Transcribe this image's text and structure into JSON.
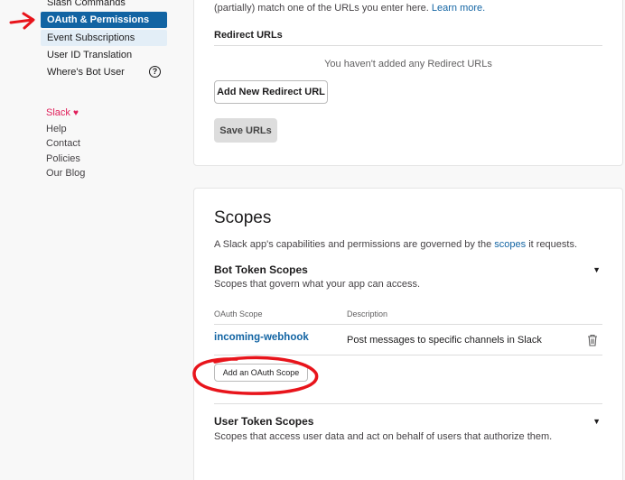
{
  "sidebar": {
    "items": [
      {
        "label": "Slash Commands"
      },
      {
        "label": "OAuth & Permissions"
      },
      {
        "label": "Event Subscriptions"
      },
      {
        "label": "User ID Translation"
      },
      {
        "label": "Where's Bot User"
      }
    ],
    "help_icon_glyph": "?",
    "footer": {
      "slack": "Slack",
      "heart": "♥",
      "help": "Help",
      "contact": "Contact",
      "policies": "Policies",
      "blog": "Our Blog"
    }
  },
  "redirect": {
    "intro_text": "(partially) match one of the URLs you enter here.",
    "learn_more": "Learn more.",
    "section_label": "Redirect URLs",
    "empty_message": "You haven't added any Redirect URLs",
    "add_button": "Add New Redirect URL",
    "save_button": "Save URLs"
  },
  "scopes": {
    "title": "Scopes",
    "description_pre": "A Slack app's capabilities and permissions are governed by the",
    "description_link": "scopes",
    "description_post": "it requests.",
    "bot": {
      "title": "Bot Token Scopes",
      "description": "Scopes that govern what your app can access.",
      "col_scope": "OAuth Scope",
      "col_description": "Description",
      "rows": [
        {
          "scope": "incoming-webhook",
          "description": "Post messages to specific channels in Slack"
        }
      ],
      "add_button": "Add an OAuth Scope"
    },
    "user": {
      "title": "User Token Scopes",
      "description": "Scopes that access user data and act on behalf of users that authorize them."
    },
    "caret_glyph": "▼"
  },
  "annotation_color": "#e8141b",
  "accent_color": "#1264a3"
}
